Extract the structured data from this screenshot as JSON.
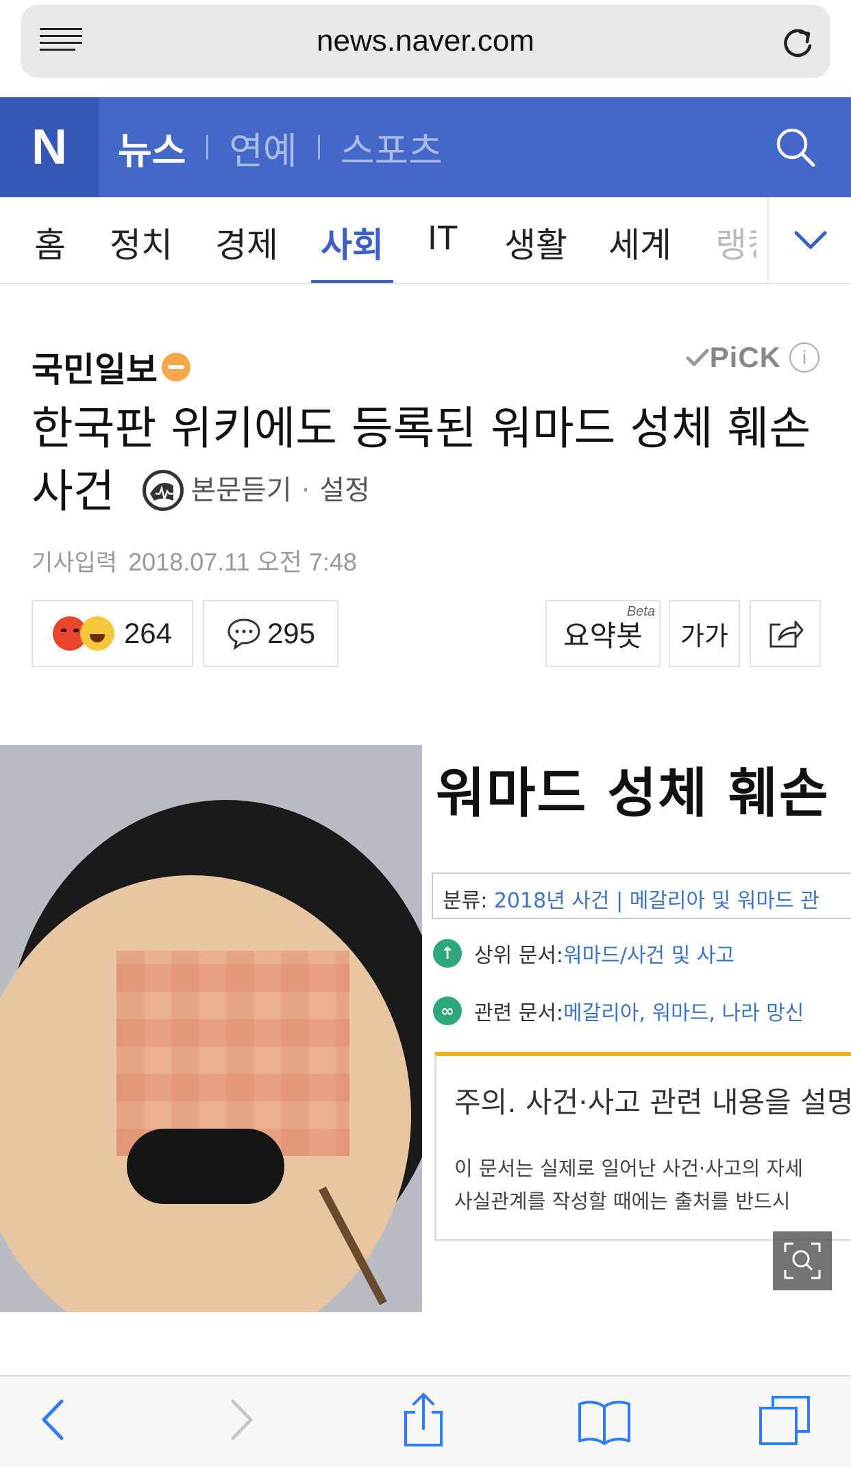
{
  "browser": {
    "url": "news.naver.com",
    "menu_icon": "menu-icon",
    "reload_icon": "reload-icon"
  },
  "header": {
    "logo": "N",
    "tabs": [
      {
        "label": "뉴스",
        "active": true
      },
      {
        "label": "연예",
        "active": false
      },
      {
        "label": "스포츠",
        "active": false
      }
    ],
    "search_icon": "search-icon",
    "color": "#4468c8"
  },
  "categories": {
    "items": [
      "홈",
      "정치",
      "경제",
      "사회",
      "IT",
      "생활",
      "세계",
      "랭킹"
    ],
    "active": "사회",
    "more_icon": "chevron-down-icon",
    "active_color": "#3c5fc5"
  },
  "article": {
    "press": "국민일보",
    "pick_label": "PiCK",
    "pick_info": "i",
    "title_main": "한국판 위키에도 등록된 워마드 성체 훼손",
    "title_tail": "사건",
    "listen_label": "본문듣기",
    "listen_dot": "·",
    "settings_label": "설정",
    "date_label": "기사입력",
    "date_value": "2018.07.11 오전 7:48",
    "reaction_count": "264",
    "comment_count": "295",
    "summary_bot_label": "요약봇",
    "summary_bot_badge": "Beta",
    "font_size_label": "가가",
    "share_icon": "share-icon"
  },
  "image": {
    "wiki_title": "워마드 성체 훼손",
    "category_prefix": "분류: ",
    "category_value": "2018년 사건 | 메갈리아 및 워마드 관",
    "parent_label": "상위 문서: ",
    "parent_value": "워마드/사건 및 사고",
    "related_label": "관련 문서: ",
    "related_value": "메갈리아, 워마드, 나라 망신",
    "notice_title": "주의. 사건·사고 관련 내용을 설명",
    "notice_line1": "이 문서는 실제로 일어난 사건·사고의 자세",
    "notice_line2": "사실관계를 작성할 때에는 출처를 반드시",
    "zoom_icon": "zoom-icon"
  },
  "toolbar": {
    "items": [
      "back-icon",
      "forward-icon",
      "share-icon",
      "bookmarks-icon",
      "tabs-icon"
    ]
  }
}
